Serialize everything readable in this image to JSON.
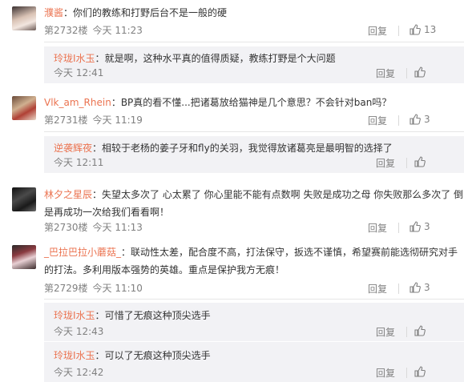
{
  "labels": {
    "floor_prefix": "第",
    "floor_suffix": "楼",
    "reply": "回复",
    "colon": "："
  },
  "comments": [
    {
      "user": "濮酱",
      "text": "你们的教练和打野后台不是一般的硬",
      "floor": "第2732楼",
      "time": "今天 11:23",
      "reply": "回复",
      "likes": "13",
      "replies": [
        {
          "user": "玲珑I水玉",
          "text": "就是啊，这种水平真的值得质疑，教练打野是个大问题",
          "time": "今天 12:41",
          "reply": "回复"
        }
      ]
    },
    {
      "user": "Vlk_am_Rhein",
      "text": "BP真的看不懂...把诸葛放给猫神是几个意思？不会针对ban吗？",
      "floor": "第2731楼",
      "time": "今天 11:19",
      "reply": "回复",
      "likes": "3",
      "replies": [
        {
          "user": "逆袭辉夜",
          "text": "相较于老杨的姜子牙和fly的关羽，我觉得放诸葛亮是最明智的选择了",
          "time": "今天 12:11",
          "reply": "回复"
        }
      ]
    },
    {
      "user": "林夕之星辰",
      "text_l1": "失望太多次了 心太累了 你心里能不能有点数啊 失败是成功之母 你失败那么多次了 倒",
      "text_l2": "是再成功一次给我们看看啊！",
      "floor": "第2730楼",
      "time": "今天 11:13",
      "reply": "回复",
      "likes": "3"
    },
    {
      "user": "_巴拉巴拉小蘑菇_",
      "text_l1": "联动性太差，配合度不高，打法保守，扳选不谨慎，希望赛前能选彻研究对手",
      "text_l2": "的打法。多利用版本强势的英雄。重点是保护我方无痕！",
      "floor": "第2729楼",
      "time": "今天 11:10",
      "reply": "回复",
      "likes": "3",
      "replies": [
        {
          "user": "玲珑I水玉",
          "text": "可惜了无痕这种顶尖选手",
          "time": "今天 12:43",
          "reply": "回复"
        },
        {
          "user": "玲珑I水玉",
          "text": "可以了无痕这种顶尖选手",
          "time": "今天 12:42",
          "reply": "回复"
        }
      ]
    }
  ]
}
